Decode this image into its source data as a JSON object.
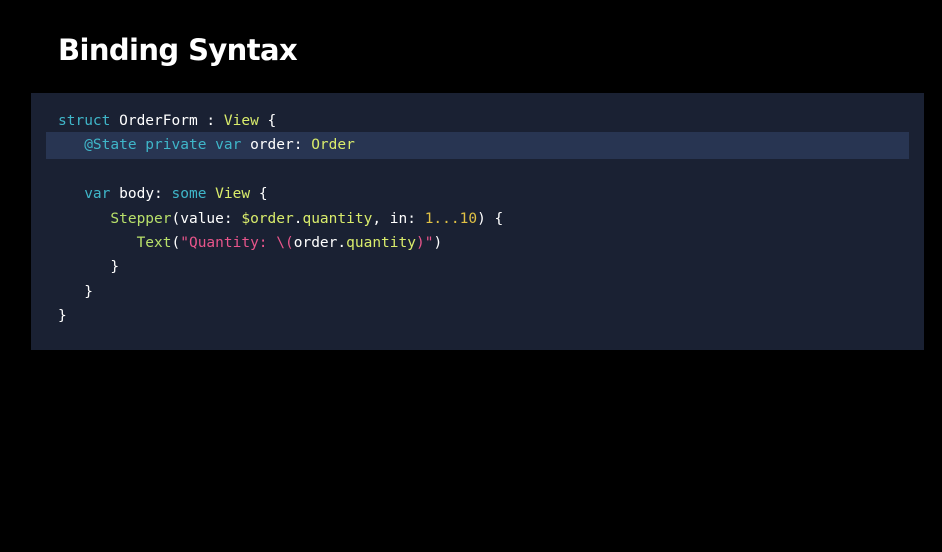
{
  "slide": {
    "title": "Binding Syntax"
  },
  "colors": {
    "background": "#000000",
    "panel": "#1a2133",
    "highlight": "#283552",
    "keyword": "#3fb6c9",
    "type": "#d9ec6b",
    "function": "#b8e06a",
    "string": "#e8558b",
    "number": "#e0c145",
    "text": "#ffffff"
  },
  "code": {
    "language": "swift",
    "highlighted_line": 2,
    "lines": [
      {
        "tokens": [
          {
            "t": "kw",
            "v": "struct"
          },
          {
            "t": "plain",
            "v": " OrderForm : "
          },
          {
            "t": "ty",
            "v": "View"
          },
          {
            "t": "plain",
            "v": " {"
          }
        ]
      },
      {
        "tokens": [
          {
            "t": "plain",
            "v": "   "
          },
          {
            "t": "kw",
            "v": "@State private var"
          },
          {
            "t": "plain",
            "v": " order: "
          },
          {
            "t": "ty",
            "v": "Order"
          }
        ]
      },
      {
        "tokens": []
      },
      {
        "tokens": [
          {
            "t": "plain",
            "v": "   "
          },
          {
            "t": "kw",
            "v": "var"
          },
          {
            "t": "plain",
            "v": " body: "
          },
          {
            "t": "kw",
            "v": "some"
          },
          {
            "t": "plain",
            "v": " "
          },
          {
            "t": "ty",
            "v": "View"
          },
          {
            "t": "plain",
            "v": " {"
          }
        ]
      },
      {
        "tokens": [
          {
            "t": "plain",
            "v": "      "
          },
          {
            "t": "fn",
            "v": "Stepper"
          },
          {
            "t": "plain",
            "v": "(value: "
          },
          {
            "t": "ty",
            "v": "$order"
          },
          {
            "t": "plain",
            "v": "."
          },
          {
            "t": "ty",
            "v": "quantity"
          },
          {
            "t": "plain",
            "v": ", in: "
          },
          {
            "t": "nu",
            "v": "1...10"
          },
          {
            "t": "plain",
            "v": ") {"
          }
        ]
      },
      {
        "tokens": [
          {
            "t": "plain",
            "v": "         "
          },
          {
            "t": "fn",
            "v": "Text"
          },
          {
            "t": "plain",
            "v": "("
          },
          {
            "t": "st",
            "v": "\"Quantity: \\("
          },
          {
            "t": "plain",
            "v": "order."
          },
          {
            "t": "ty",
            "v": "quantity"
          },
          {
            "t": "st",
            "v": ")\""
          },
          {
            "t": "plain",
            "v": ")"
          }
        ]
      },
      {
        "tokens": [
          {
            "t": "plain",
            "v": "      }"
          }
        ]
      },
      {
        "tokens": [
          {
            "t": "plain",
            "v": "   }"
          }
        ]
      },
      {
        "tokens": [
          {
            "t": "plain",
            "v": "}"
          }
        ]
      }
    ]
  }
}
